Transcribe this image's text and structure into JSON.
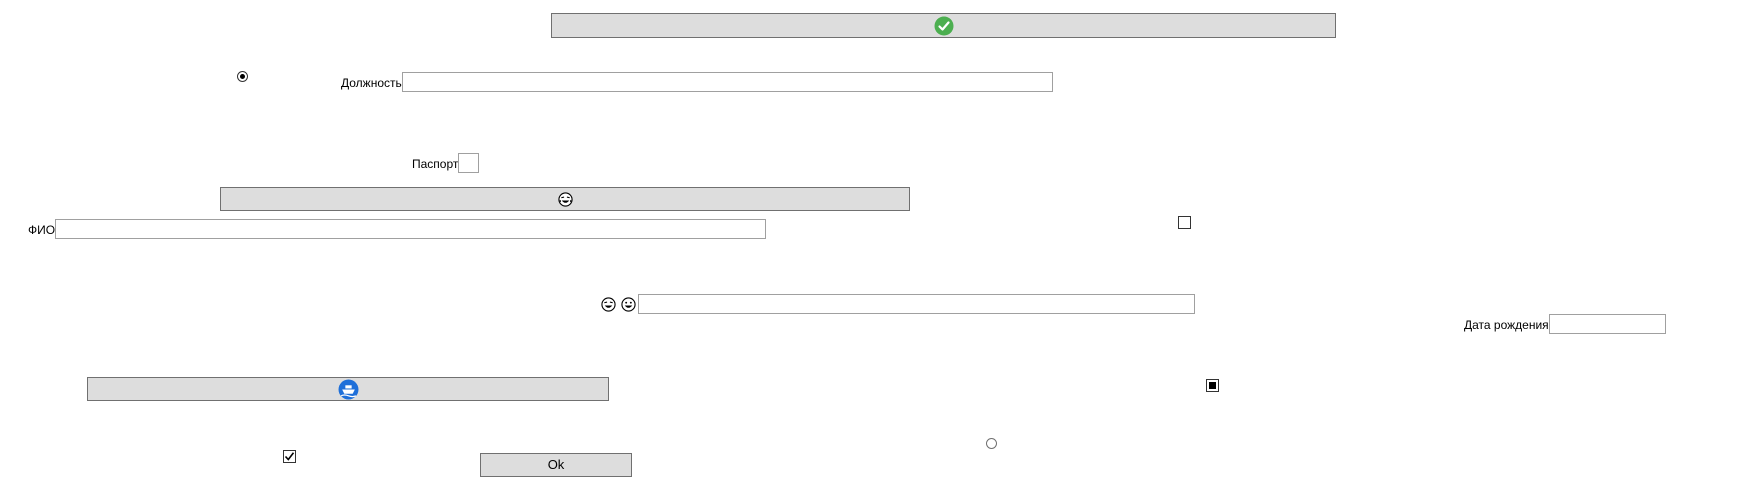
{
  "buttons": {
    "confirm": {
      "icon": "check-circle-icon",
      "color": "#4caf50"
    },
    "emoji": {
      "icon": "laughing-face-icon"
    },
    "ship": {
      "icon": "ship-icon",
      "color": "#1e6fd9"
    },
    "ok": {
      "label": "Ok"
    }
  },
  "fields": {
    "position": {
      "label": "Должность",
      "value": ""
    },
    "passport": {
      "label": "Паспорт",
      "value": ""
    },
    "fio": {
      "label": "ФИО",
      "value": ""
    },
    "emoji_input": {
      "value": ""
    },
    "birth_date": {
      "label": "Дата рождения",
      "value": ""
    }
  },
  "radios": {
    "top": {
      "checked": true
    },
    "bottom": {
      "checked": false
    }
  },
  "checkboxes": {
    "right_top": {
      "checked": false
    },
    "right_mid": {
      "state": "indeterminate"
    },
    "left_bottom": {
      "checked": true
    }
  },
  "icons": {
    "emoji_label_1": "laughing-face-icon",
    "emoji_label_2": "grinning-face-icon"
  }
}
